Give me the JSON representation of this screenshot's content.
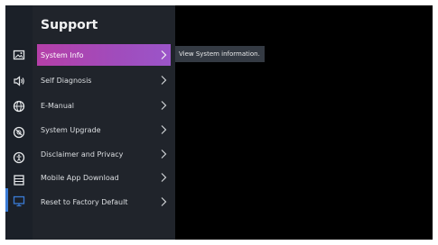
{
  "panel": {
    "title": "Support",
    "items": [
      {
        "label": "System Info",
        "selected": true
      },
      {
        "label": "Self Diagnosis"
      },
      {
        "label": "E-Manual"
      },
      {
        "label": "System Upgrade"
      },
      {
        "label": "Disclaimer and Privacy"
      },
      {
        "label": "Mobile App Download"
      },
      {
        "label": "Reset to Factory Default"
      }
    ]
  },
  "tooltip": {
    "text": "View System information."
  },
  "rail": {
    "icons": [
      "picture-icon",
      "sound-icon",
      "network-icon",
      "general-icon",
      "accessibility-icon",
      "list-icon",
      "support-icon"
    ],
    "active": "support-icon"
  },
  "colors": {
    "selected_gradient_start": "#b53fa8",
    "selected_gradient_end": "#9b55c9",
    "rail_active": "#3a7bd5"
  }
}
